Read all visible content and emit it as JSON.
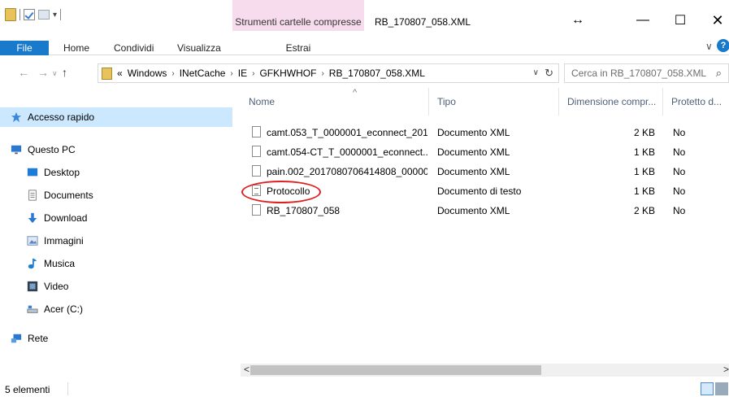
{
  "window": {
    "title": "RB_170807_058.XML",
    "context_tab_title": "Strumenti cartelle compresse",
    "controls": {
      "expand": "↔",
      "minimize": "—",
      "maximize": "☐",
      "close": "✕"
    }
  },
  "ribbon": {
    "tabs": [
      {
        "label": "File"
      },
      {
        "label": "Home"
      },
      {
        "label": "Condividi"
      },
      {
        "label": "Visualizza"
      },
      {
        "label": "Estrai"
      }
    ],
    "chevron": "∨",
    "help": "?"
  },
  "nav": {
    "back": "←",
    "forward": "→",
    "recent": "∨",
    "up": "↑",
    "breadcrumb_overflow": "«",
    "breadcrumbs": [
      "Windows",
      "INetCache",
      "IE",
      "GFKHWHOF",
      "RB_170807_058.XML"
    ],
    "separator": "›",
    "dropdown": "∨",
    "refresh": "↻",
    "search_placeholder": "Cerca in RB_170807_058.XML",
    "search_icon": "⌕"
  },
  "sidebar": {
    "items": [
      {
        "label": "Accesso rapido",
        "icon": "star-icon"
      },
      {
        "label": "Questo PC",
        "icon": "computer-icon"
      },
      {
        "label": "Desktop",
        "icon": "desktop-icon"
      },
      {
        "label": "Documents",
        "icon": "documents-icon"
      },
      {
        "label": "Download",
        "icon": "download-icon"
      },
      {
        "label": "Immagini",
        "icon": "pictures-icon"
      },
      {
        "label": "Musica",
        "icon": "music-icon"
      },
      {
        "label": "Video",
        "icon": "video-icon"
      },
      {
        "label": "Acer (C:)",
        "icon": "drive-icon"
      },
      {
        "label": "Rete",
        "icon": "network-icon"
      }
    ]
  },
  "table": {
    "columns": [
      "Nome",
      "Tipo",
      "Dimensione compr...",
      "Protetto d..."
    ],
    "sort_indicator": "^",
    "rows": [
      {
        "name": "camt.053_T_0000001_econnect_201...",
        "type": "Documento XML",
        "size": "2 KB",
        "protected": "No",
        "icon": "xml-file-icon"
      },
      {
        "name": "camt.054-CT_T_0000001_econnect...",
        "type": "Documento XML",
        "size": "1 KB",
        "protected": "No",
        "icon": "xml-file-icon"
      },
      {
        "name": "pain.002_2017080706414808_00000...",
        "type": "Documento XML",
        "size": "1 KB",
        "protected": "No",
        "icon": "xml-file-icon"
      },
      {
        "name": "Protocollo",
        "type": "Documento di testo",
        "size": "1 KB",
        "protected": "No",
        "icon": "text-file-icon"
      },
      {
        "name": "RB_170807_058",
        "type": "Documento XML",
        "size": "2 KB",
        "protected": "No",
        "icon": "xml-file-icon"
      }
    ]
  },
  "scrollbar": {
    "left_arrow": "<",
    "right_arrow": ">"
  },
  "status": {
    "count": "5 elementi"
  },
  "colors": {
    "accent": "#1979ca",
    "context_tab": "#f7dced",
    "highlight_ring": "#e02020",
    "selection": "#cce8ff"
  }
}
